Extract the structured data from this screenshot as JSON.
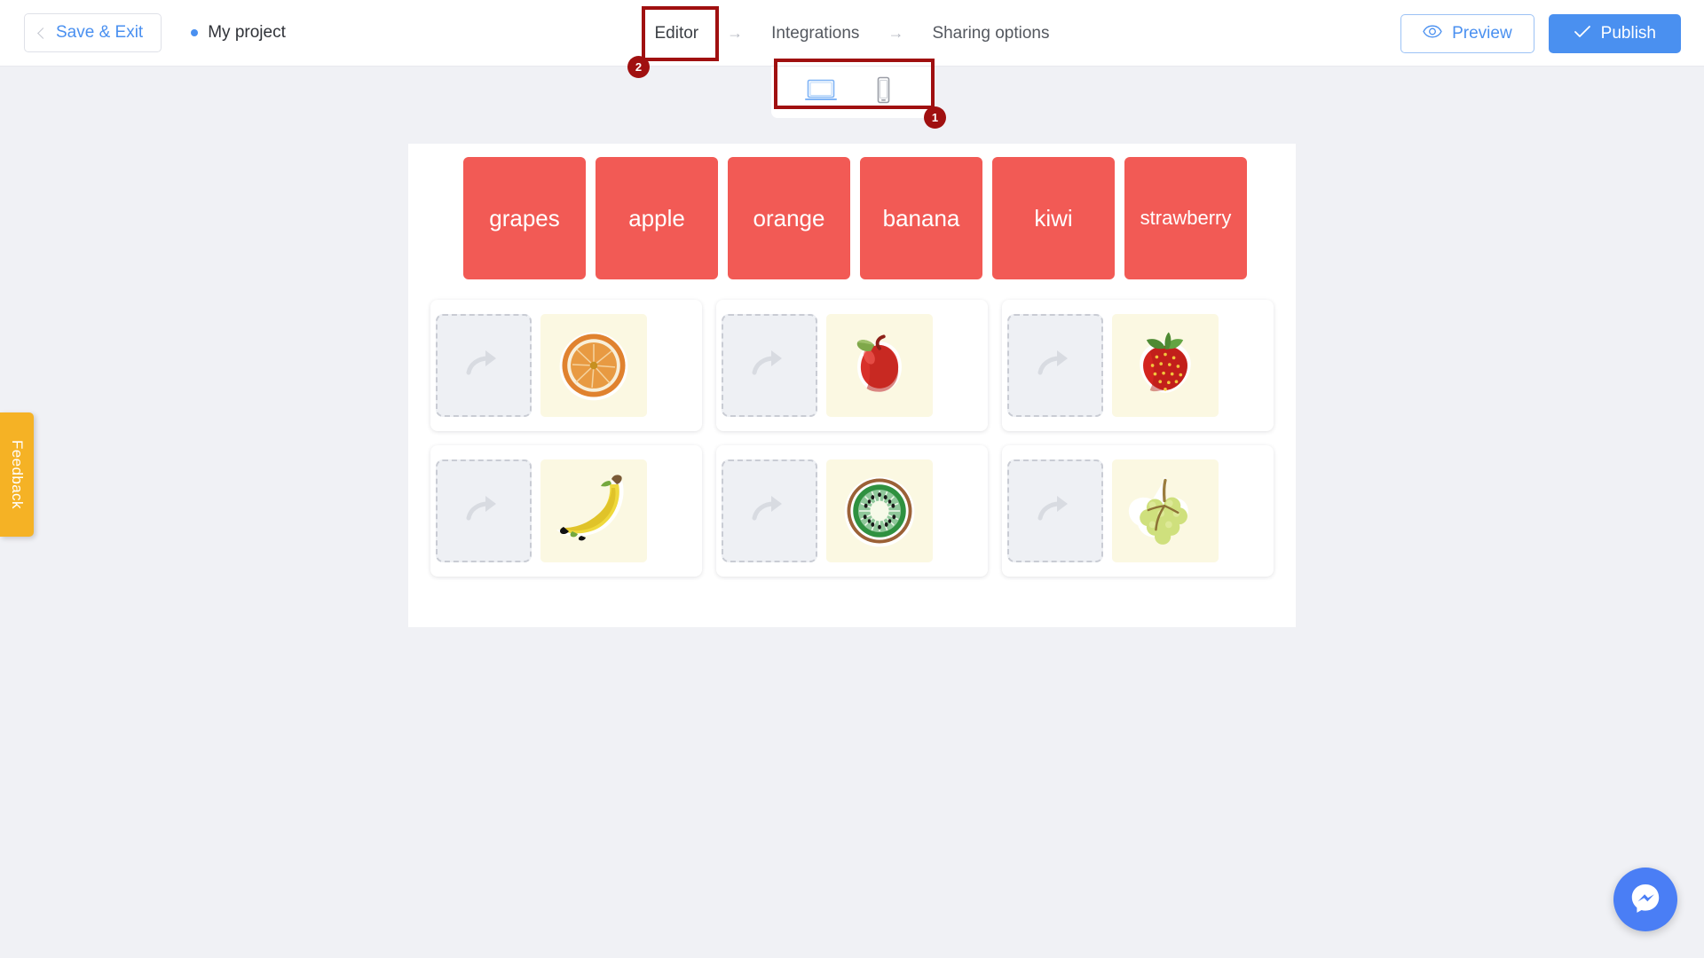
{
  "header": {
    "save_exit_label": "Save & Exit",
    "project_name": "My project",
    "breadcrumbs": [
      {
        "label": "Editor",
        "active": true
      },
      {
        "label": "Integrations",
        "active": false
      },
      {
        "label": "Sharing options",
        "active": false
      }
    ],
    "breadcrumb_arrow": "→",
    "preview_label": "Preview",
    "publish_label": "Publish"
  },
  "device_toggle": {
    "desktop_label": "desktop-view",
    "mobile_label": "mobile-view",
    "selected": "desktop"
  },
  "annotations": [
    {
      "id": "1",
      "target": "device-toggle"
    },
    {
      "id": "2",
      "target": "editor-breadcrumb"
    }
  ],
  "canvas": {
    "word_cards": [
      {
        "label": "grapes",
        "size": "normal"
      },
      {
        "label": "apple",
        "size": "normal"
      },
      {
        "label": "orange",
        "size": "normal"
      },
      {
        "label": "banana",
        "size": "normal"
      },
      {
        "label": "kiwi",
        "size": "normal"
      },
      {
        "label": "strawberry",
        "size": "small"
      }
    ],
    "pairs": [
      {
        "image": "orange",
        "dropzone_placeholder": "drop-arrow"
      },
      {
        "image": "apple",
        "dropzone_placeholder": "drop-arrow"
      },
      {
        "image": "strawberry",
        "dropzone_placeholder": "drop-arrow"
      },
      {
        "image": "banana",
        "dropzone_placeholder": "drop-arrow"
      },
      {
        "image": "kiwi",
        "dropzone_placeholder": "drop-arrow"
      },
      {
        "image": "grapes",
        "dropzone_placeholder": "drop-arrow"
      }
    ]
  },
  "feedback": {
    "label": "Feedback"
  },
  "messenger": {
    "label": "messenger-chat"
  },
  "colors": {
    "accent_blue": "#4a90f0",
    "card_red": "#f25a55",
    "feedback_amber": "#f5b225",
    "highlight_red": "#a01010",
    "page_bg": "#f0f1f5",
    "image_cell_bg": "#fbf8e2"
  }
}
